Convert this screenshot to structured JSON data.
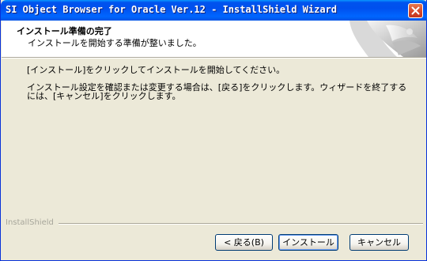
{
  "window": {
    "title": "SI Object Browser for Oracle Ver.12 - InstallShield Wizard"
  },
  "header": {
    "title": "インストール準備の完了",
    "subtitle": "インストールを開始する準備が整いました。"
  },
  "body": {
    "line1": "[インストール]をクリックしてインストールを開始してください。",
    "line2": "インストール設定を確認または変更する場合は、[戻る]をクリックします。ウィザードを終了するには、[キャンセル]をクリックします。"
  },
  "footer": {
    "brand": "InstallShield"
  },
  "buttons": {
    "back": "< 戻る(B)",
    "install": "インストール",
    "cancel": "キャンセル"
  },
  "icons": {
    "close": "close-icon",
    "header_graphic": "install-computer-graphic"
  },
  "colors": {
    "titlebar": "#0053ee",
    "close_button": "#d4462a",
    "dialog_bg": "#ece9d8"
  }
}
